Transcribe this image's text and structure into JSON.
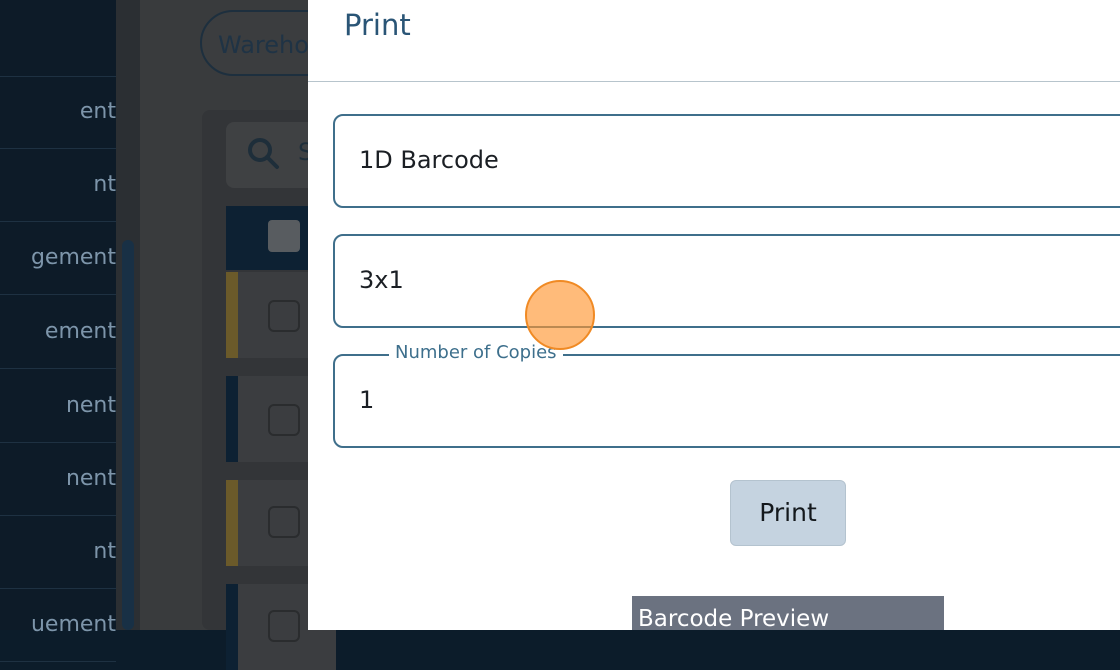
{
  "sidebar": {
    "items": [
      {
        "label": "ent"
      },
      {
        "label": "nt"
      },
      {
        "label": "gement"
      },
      {
        "label": "ement"
      },
      {
        "label": "nent"
      },
      {
        "label": "nent"
      },
      {
        "label": "nt"
      },
      {
        "label": "uement"
      }
    ]
  },
  "background": {
    "warehouse_filter": "Wareho",
    "search_placeholder": "S"
  },
  "dialog": {
    "title": "Print",
    "barcode_type": "1D Barcode",
    "label_size": "3x1",
    "copies_label": "Number of Copies",
    "copies_value": "1",
    "print_button": "Print",
    "preview_header": "Barcode Preview"
  },
  "colors": {
    "accent": "#3f6f8b",
    "title": "#2a5576",
    "cursor": "#f08a24"
  }
}
